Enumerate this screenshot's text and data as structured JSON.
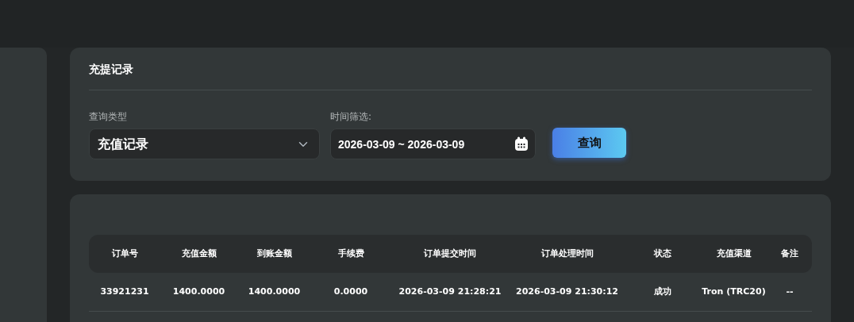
{
  "card_title": "充提记录",
  "filters": [
    {
      "kind": "select",
      "label": "查询类型",
      "value": "充值记录"
    },
    {
      "kind": "date",
      "label": "时间筛选:",
      "value": "2026-03-09 ~ 2026-03-09"
    }
  ],
  "query_button": "查询",
  "table": {
    "columns": [
      "订单号",
      "充值金额",
      "到账金额",
      "手续费",
      "订单提交时间",
      "订单处理时间",
      "状态",
      "充值渠道",
      "备注"
    ],
    "rows": [
      [
        "33921231",
        "1400.0000",
        "1400.0000",
        "0.0000",
        "2026-03-09 21:28:21",
        "2026-03-09 21:30:12",
        "成功",
        "Tron (TRC20)",
        "--"
      ]
    ]
  }
}
